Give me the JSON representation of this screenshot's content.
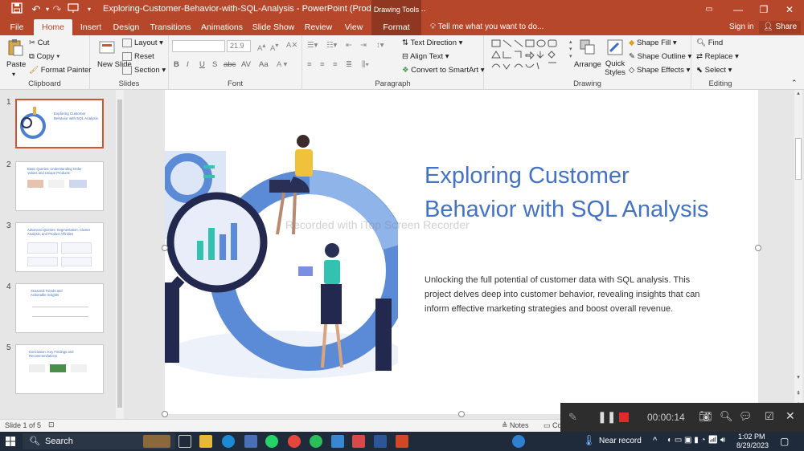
{
  "titlebar": {
    "document_title": "Exploring-Customer-Behavior-with-SQL-Analysis - PowerPoint (Product Activatio...",
    "contextual_tab_group": "Drawing Tools"
  },
  "tabs": [
    {
      "label": "File"
    },
    {
      "label": "Home"
    },
    {
      "label": "Insert"
    },
    {
      "label": "Design"
    },
    {
      "label": "Transitions"
    },
    {
      "label": "Animations"
    },
    {
      "label": "Slide Show"
    },
    {
      "label": "Review"
    },
    {
      "label": "View"
    },
    {
      "label": "Format"
    }
  ],
  "tell_me": "Tell me what you want to do...",
  "sign_in": "Sign in",
  "share": "Share",
  "ribbon": {
    "clipboard": {
      "paste": "Paste",
      "cut": "Cut",
      "copy": "Copy",
      "format_painter": "Format Painter",
      "label": "Clipboard"
    },
    "slides": {
      "new_slide": "New Slide",
      "layout": "Layout",
      "reset": "Reset",
      "section": "Section",
      "label": "Slides"
    },
    "font": {
      "font_size": "21.9",
      "label": "Font"
    },
    "paragraph": {
      "text_direction": "Text Direction",
      "align_text": "Align Text",
      "smartart": "Convert to SmartArt",
      "label": "Paragraph"
    },
    "drawing": {
      "arrange": "Arrange",
      "quick_styles": "Quick Styles",
      "shape_fill": "Shape Fill",
      "shape_outline": "Shape Outline",
      "shape_effects": "Shape Effects",
      "label": "Drawing"
    },
    "editing": {
      "find": "Find",
      "replace": "Replace",
      "select": "Select",
      "label": "Editing"
    }
  },
  "thumbnails": [
    {
      "num": "1",
      "title": "Exploring Customer Behavior with SQL Analysis"
    },
    {
      "num": "2",
      "title": "Basic Queries: Understanding Order Values and Unique Products"
    },
    {
      "num": "3",
      "title": "Advanced Queries: Segmentation, Cluster Analysis, and Product Affinities"
    },
    {
      "num": "4",
      "title": "Seasonal Trends and Actionable Insights"
    },
    {
      "num": "5",
      "title": "Conclusion: Key Findings and Recommendations"
    }
  ],
  "slide": {
    "title": "Exploring Customer Behavior with SQL Analysis",
    "body": "Unlocking the full potential of customer data with SQL analysis. This project delves deep into customer behavior, revealing insights that can inform effective marketing strategies and boost overall revenue.",
    "watermark": "Recorded with iTop Screen Recorder"
  },
  "status": {
    "slide_of": "Slide 1 of 5",
    "notes": "Notes",
    "comments_partial": "Co"
  },
  "recorder": {
    "timer": "00:00:14"
  },
  "taskbar": {
    "search": "Search",
    "near_record": "Near record",
    "time": "1:02 PM",
    "date": "8/29/2023"
  },
  "colors": {
    "ppt_accent": "#b7472a",
    "title_blue": "#4472c4",
    "selected_thumb": "#d35230",
    "record_red": "#e02a2a"
  }
}
